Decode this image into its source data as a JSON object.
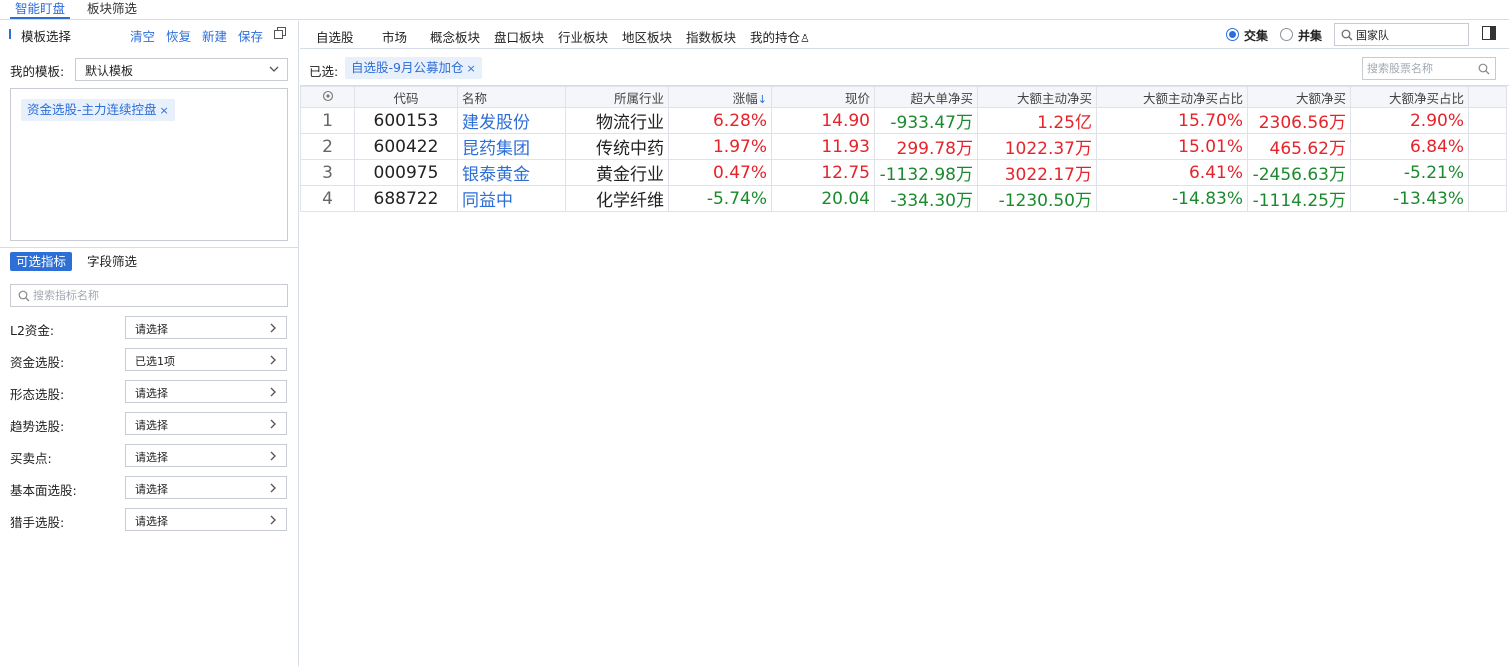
{
  "top_tabs": [
    {
      "label": "智能盯盘",
      "active": true
    },
    {
      "label": "板块筛选",
      "active": false
    }
  ],
  "left_panel": {
    "title": "模板选择",
    "actions": [
      "清空",
      "恢复",
      "新建",
      "保存"
    ],
    "my_template_label": "我的模板:",
    "my_template_value": "默认模板",
    "selected_tag": "资金选股-主力连续控盘",
    "sub_tabs": [
      {
        "label": "可选指标",
        "active": true
      },
      {
        "label": "字段筛选",
        "active": false
      }
    ],
    "indicator_search_placeholder": "搜索指标名称",
    "filters": [
      {
        "label": "L2资金:",
        "value": "请选择"
      },
      {
        "label": "资金选股:",
        "value": "已选1项"
      },
      {
        "label": "形态选股:",
        "value": "请选择"
      },
      {
        "label": "趋势选股:",
        "value": "请选择"
      },
      {
        "label": "买卖点:",
        "value": "请选择"
      },
      {
        "label": "基本面选股:",
        "value": "请选择"
      },
      {
        "label": "猎手选股:",
        "value": "请选择"
      }
    ]
  },
  "right_panel": {
    "categories": [
      "自选股",
      "市场",
      "概念板块",
      "盘口板块",
      "行业板块",
      "地区板块",
      "指数板块",
      "我的持仓"
    ],
    "radio_options": [
      {
        "label": "交集",
        "checked": true
      },
      {
        "label": "并集",
        "checked": false
      }
    ],
    "group_search_value": "国家队",
    "selected_label": "已选:",
    "selected_tag": "自选股-9月公募加仓",
    "stock_search_placeholder": "搜索股票名称"
  },
  "table": {
    "columns": [
      "代码",
      "名称",
      "所属行业",
      "涨幅",
      "现价",
      "超大单净买",
      "大额主动净买",
      "大额主动净买占比",
      "大额净买",
      "大额净买占比"
    ],
    "sort_indicator": "↓",
    "rows": [
      {
        "idx": "1",
        "code": "600153",
        "name": "建发股份",
        "industry": "物流行业",
        "change": "6.28%",
        "price": "14.90",
        "xl_net": "-933.47万",
        "l_active_net": "1.25亿",
        "l_active_ratio": "15.70%",
        "l_net": "2306.56万",
        "l_net_ratio": "2.90%"
      },
      {
        "idx": "2",
        "code": "600422",
        "name": "昆药集团",
        "industry": "传统中药",
        "change": "1.97%",
        "price": "11.93",
        "xl_net": "299.78万",
        "l_active_net": "1022.37万",
        "l_active_ratio": "15.01%",
        "l_net": "465.62万",
        "l_net_ratio": "6.84%"
      },
      {
        "idx": "3",
        "code": "000975",
        "name": "银泰黄金",
        "industry": "黄金行业",
        "change": "0.47%",
        "price": "12.75",
        "xl_net": "-1132.98万",
        "l_active_net": "3022.17万",
        "l_active_ratio": "6.41%",
        "l_net": "-2456.63万",
        "l_net_ratio": "-5.21%"
      },
      {
        "idx": "4",
        "code": "688722",
        "name": "同益中",
        "industry": "化学纤维",
        "change": "-5.74%",
        "price": "20.04",
        "xl_net": "-334.30万",
        "l_active_net": "-1230.50万",
        "l_active_ratio": "-14.83%",
        "l_net": "-1114.25万",
        "l_net_ratio": "-13.43%"
      }
    ]
  },
  "colors": {
    "accent": "#2d6ed7",
    "up": "#e5232a",
    "down": "#1b8a2e",
    "tag_bg": "#e8f0fc"
  },
  "icons": {
    "copy": "copy-icon",
    "search": "search-icon",
    "chevron": "chevron-right-icon",
    "settings": "settings-circle-icon",
    "panel": "panel-toggle-icon"
  }
}
